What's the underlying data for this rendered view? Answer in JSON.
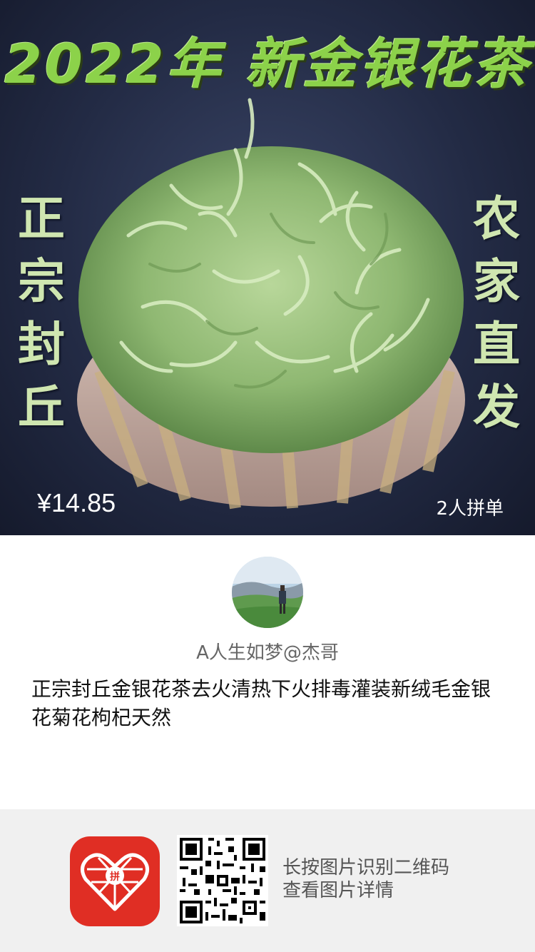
{
  "poster": {
    "title": "2022年 新金银花茶",
    "left_slogan": "正宗封丘",
    "right_slogan": "农家直发",
    "price": "¥14.85",
    "group_buy": "2人拼单"
  },
  "seller": {
    "name": "A人生如梦@杰哥"
  },
  "product": {
    "title": "正宗封丘金银花茶去火清热下火排毒灌装新绒毛金银花菊花枸杞天然"
  },
  "footer": {
    "app_icon": "pinduoduo-logo-icon",
    "qr_icon": "qr-code-icon",
    "hint_line1": "长按图片识别二维码",
    "hint_line2": "查看图片详情"
  },
  "colors": {
    "title_green": "#8cd24a",
    "slogan_green": "#cfe6b0",
    "brand_red": "#e02e24",
    "footer_bg": "#f0f0f0"
  }
}
